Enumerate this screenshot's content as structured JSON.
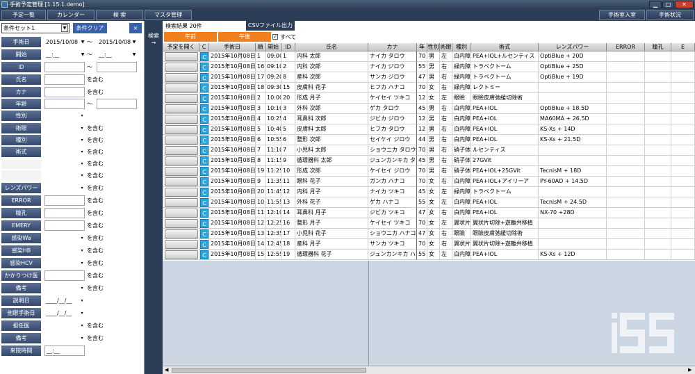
{
  "window": {
    "title": "手術予定管理 [1.15.1.demo]"
  },
  "menu": {
    "items": [
      "予定一覧",
      "カレンダー",
      "検 索",
      "マスタ管理"
    ],
    "right_items": [
      "手術室入室",
      "手術状況"
    ]
  },
  "sidebar": {
    "set_value": "条件セット1",
    "clear_label": "条件クリア",
    "close_label": "×",
    "fields": [
      {
        "label": "手術日",
        "type": "daterange",
        "from": "2015/10/08",
        "to": "2015/10/08",
        "sep": "～"
      },
      {
        "label": "開始",
        "type": "timerange",
        "from": "__:__",
        "to": "__:__",
        "sep": "～"
      },
      {
        "label": "ID",
        "type": "range",
        "sep": "～"
      },
      {
        "label": "氏名",
        "type": "text",
        "suffix": "を含む"
      },
      {
        "label": "カナ",
        "type": "text",
        "suffix": "を含む"
      },
      {
        "label": "年齢",
        "type": "range",
        "sep": "～"
      },
      {
        "label": "性別",
        "type": "select"
      },
      {
        "label": "術眼",
        "type": "select",
        "suffix": "を含む"
      },
      {
        "label": "種別",
        "type": "select",
        "suffix": "を含む"
      },
      {
        "label": "術式",
        "type": "select",
        "suffix": "を含む"
      },
      {
        "label": "",
        "type": "select",
        "suffix": "を含む"
      },
      {
        "label": "",
        "type": "select",
        "suffix": "を含む"
      },
      {
        "label": "レンズパワー",
        "type": "select",
        "suffix": "を含む"
      },
      {
        "label": "ERROR",
        "type": "text",
        "suffix": "を含む"
      },
      {
        "label": "瞳孔",
        "type": "text",
        "suffix": "を含む"
      },
      {
        "label": "EMERY",
        "type": "text",
        "suffix": "を含む"
      },
      {
        "label": "感染Wa",
        "type": "select",
        "suffix": "を含む"
      },
      {
        "label": "感染HB",
        "type": "select",
        "suffix": "を含む"
      },
      {
        "label": "感染HCV",
        "type": "select",
        "suffix": "を含む"
      },
      {
        "label": "かかりつけ医",
        "type": "text",
        "suffix": "を含む"
      },
      {
        "label": "備考",
        "type": "select",
        "suffix": "を含む"
      },
      {
        "label": "説明日",
        "type": "date",
        "value": "____/__/__"
      },
      {
        "label": "他眼手術日",
        "type": "date",
        "value": "____/__/__"
      },
      {
        "label": "担任医",
        "type": "select",
        "suffix": "を含む"
      },
      {
        "label": "備考",
        "type": "select",
        "suffix": "を含む"
      },
      {
        "label": "来院時間",
        "type": "time",
        "value": "__:__"
      }
    ]
  },
  "search_strip": {
    "label": "検索",
    "arrow": "→"
  },
  "results": {
    "count_text": "検索結果 20件",
    "csv_label": "CSVファイル出力"
  },
  "filters": {
    "am_label": "午前",
    "pm_label": "午後",
    "all_label": "すべて",
    "all_checked": true
  },
  "table": {
    "headers": [
      "予定を開く",
      "C",
      "手術日",
      "順",
      "開始",
      "ID",
      "氏名",
      "カナ",
      "年",
      "性別",
      "術眼",
      "種別",
      "術式",
      "レンズパワー",
      "ERROR",
      "瞳孔",
      "E"
    ],
    "rows": [
      [
        "C",
        "2015年10月08日",
        "1",
        "09:00",
        "1",
        "内科 太郎",
        "ナイカ タロウ",
        "70",
        "男",
        "左",
        "白内障",
        "PEA+IOL+ルセンティス",
        "OptiBlue + 20D"
      ],
      [
        "C",
        "2015年10月08日",
        "16",
        "09:10",
        "2",
        "内科 次郎",
        "ナイカ ジロウ",
        "55",
        "男",
        "右",
        "緑内障",
        "トラベクトーム",
        "OptiBlue + 25D"
      ],
      [
        "C",
        "2015年10月08日",
        "17",
        "09:20",
        "8",
        "産科 次郎",
        "サンカ ジロウ",
        "47",
        "男",
        "右",
        "緑内障",
        "トラベクトーム",
        "OptiBlue + 19D"
      ],
      [
        "C",
        "2015年10月08日",
        "18",
        "09:30",
        "15",
        "皮膚科 花子",
        "ヒフカ ハナコ",
        "70",
        "女",
        "右",
        "緑内障",
        "レクトミー",
        ""
      ],
      [
        "C",
        "2015年10月08日",
        "2",
        "10:00",
        "20",
        "形成 月子",
        "ケイセイ ツキコ",
        "12",
        "女",
        "左",
        "眼瞼",
        "眼瞼皮膚弛緩切除術",
        ""
      ],
      [
        "C",
        "2015年10月08日",
        "3",
        "10:10",
        "3",
        "外科 次郎",
        "ゲカ タロウ",
        "45",
        "男",
        "右",
        "白内障",
        "PEA+IOL",
        "OptiBlue + 18.5D"
      ],
      [
        "C",
        "2015年10月08日",
        "4",
        "10:25",
        "4",
        "耳鼻科 次郎",
        "ジビカ ジロウ",
        "12",
        "男",
        "右",
        "白内障",
        "PEA+IOL",
        "MA60MA + 26.5D"
      ],
      [
        "C",
        "2015年10月08日",
        "5",
        "10:40",
        "5",
        "皮膚科 太郎",
        "ヒフカ タロウ",
        "12",
        "男",
        "右",
        "白内障",
        "PEA+IOL",
        "KS-Xs + 14D"
      ],
      [
        "C",
        "2015年10月08日",
        "6",
        "10:55",
        "6",
        "整形 次郎",
        "セイケイ ジロウ",
        "44",
        "男",
        "右",
        "白内障",
        "PEA+IOL",
        "KS-Xs + 21.5D"
      ],
      [
        "C",
        "2015年10月08日",
        "7",
        "11:10",
        "7",
        "小児科 太郎",
        "ショウニカ タロウ",
        "70",
        "男",
        "右",
        "硝子体内注射",
        "ルセンティス",
        ""
      ],
      [
        "C",
        "2015年10月08日",
        "8",
        "11:15",
        "9",
        "循環器科 太郎",
        "ジュンカンキカ タロウ",
        "45",
        "男",
        "右",
        "硝子体",
        "27GVit",
        ""
      ],
      [
        "C",
        "2015年10月08日",
        "19",
        "11:25",
        "10",
        "形成 次郎",
        "ケイセイ ジロウ",
        "70",
        "男",
        "右",
        "硝子体",
        "PEA+IOL+25GVit",
        "TecnisM + 18D"
      ],
      [
        "C",
        "2015年10月08日",
        "9",
        "11:35",
        "11",
        "眼科 花子",
        "ガンカ ハナコ",
        "70",
        "女",
        "右",
        "白内障",
        "PEA+IOL+アイリーア",
        "PY-60AD + 14.5D"
      ],
      [
        "C",
        "2015年10月08日",
        "20",
        "11:45",
        "12",
        "内科 月子",
        "ナイカ ツキコ",
        "45",
        "女",
        "左",
        "緑内障",
        "トラベクトーム",
        ""
      ],
      [
        "C",
        "2015年10月08日",
        "10",
        "11:55",
        "13",
        "外科 花子",
        "ゲカ ハナコ",
        "55",
        "女",
        "左",
        "白内障",
        "PEA+IOL",
        "TecnisM + 24.5D"
      ],
      [
        "C",
        "2015年10月08日",
        "11",
        "12:10",
        "14",
        "耳鼻科 月子",
        "ジビカ ツキコ",
        "47",
        "女",
        "右",
        "白内障",
        "PEA+IOL",
        "NX-70 +28D"
      ],
      [
        "C",
        "2015年10月08日",
        "12",
        "12:25",
        "16",
        "整形 月子",
        "ケイセイ ツキコ",
        "70",
        "女",
        "左",
        "翼状片",
        "翼状片切除+遊離弁移植",
        ""
      ],
      [
        "C",
        "2015年10月08日",
        "13",
        "12:35",
        "17",
        "小児科 花子",
        "ショウニカ ハナコ",
        "47",
        "女",
        "右",
        "眼瞼",
        "眼瞼皮膚弛緩切除術",
        ""
      ],
      [
        "C",
        "2015年10月08日",
        "14",
        "12:45",
        "18",
        "産科 月子",
        "サンカ ツキコ",
        "70",
        "女",
        "右",
        "翼状片",
        "翼状片切除+遊離弁移植",
        ""
      ],
      [
        "C",
        "2015年10月08日",
        "15",
        "12:55",
        "19",
        "循環器科 花子",
        "ジュンカンキカ ハナコ",
        "55",
        "女",
        "左",
        "白内障",
        "PEA+IOL",
        "KS-Xs + 12D"
      ]
    ]
  },
  "logo": {
    "text": "iSS"
  },
  "colors": {
    "menu": "#2b3d57",
    "label": "#3b4f74",
    "orange": "#f0801e",
    "c_button": "#27a6e0",
    "grey_area": "#cbd6e2"
  }
}
